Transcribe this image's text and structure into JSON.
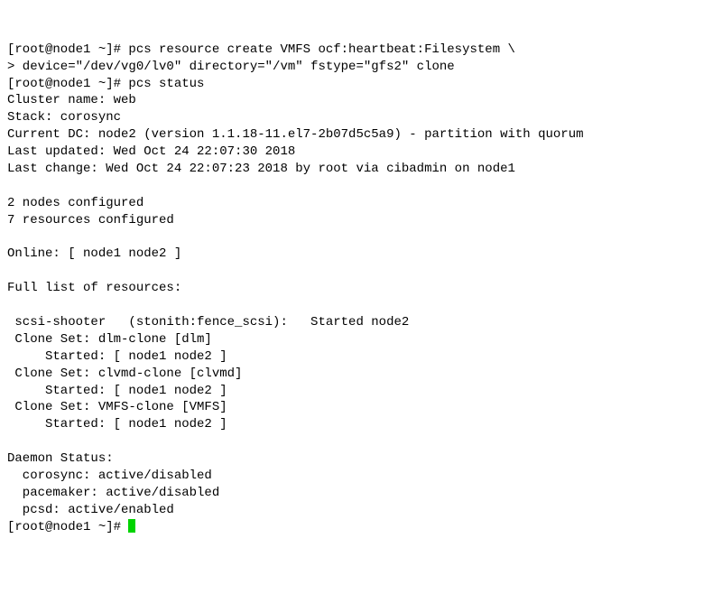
{
  "lines": {
    "l0": "[root@node1 ~]# pcs resource create VMFS ocf:heartbeat:Filesystem \\",
    "l1": "> device=\"/dev/vg0/lv0\" directory=\"/vm\" fstype=\"gfs2\" clone",
    "l2": "[root@node1 ~]# pcs status",
    "l3": "Cluster name: web",
    "l4": "Stack: corosync",
    "l5": "Current DC: node2 (version 1.1.18-11.el7-2b07d5c5a9) - partition with quorum",
    "l6": "Last updated: Wed Oct 24 22:07:30 2018",
    "l7": "Last change: Wed Oct 24 22:07:23 2018 by root via cibadmin on node1",
    "l8": "",
    "l9": "2 nodes configured",
    "l10": "7 resources configured",
    "l11": "",
    "l12": "Online: [ node1 node2 ]",
    "l13": "",
    "l14": "Full list of resources:",
    "l15": "",
    "l16": " scsi-shooter   (stonith:fence_scsi):   Started node2",
    "l17": " Clone Set: dlm-clone [dlm]",
    "l18": "     Started: [ node1 node2 ]",
    "l19": " Clone Set: clvmd-clone [clvmd]",
    "l20": "     Started: [ node1 node2 ]",
    "l21": " Clone Set: VMFS-clone [VMFS]",
    "l22": "     Started: [ node1 node2 ]",
    "l23": "",
    "l24": "Daemon Status:",
    "l25": "  corosync: active/disabled",
    "l26": "  pacemaker: active/disabled",
    "l27": "  pcsd: active/enabled",
    "l28": "[root@node1 ~]# "
  }
}
